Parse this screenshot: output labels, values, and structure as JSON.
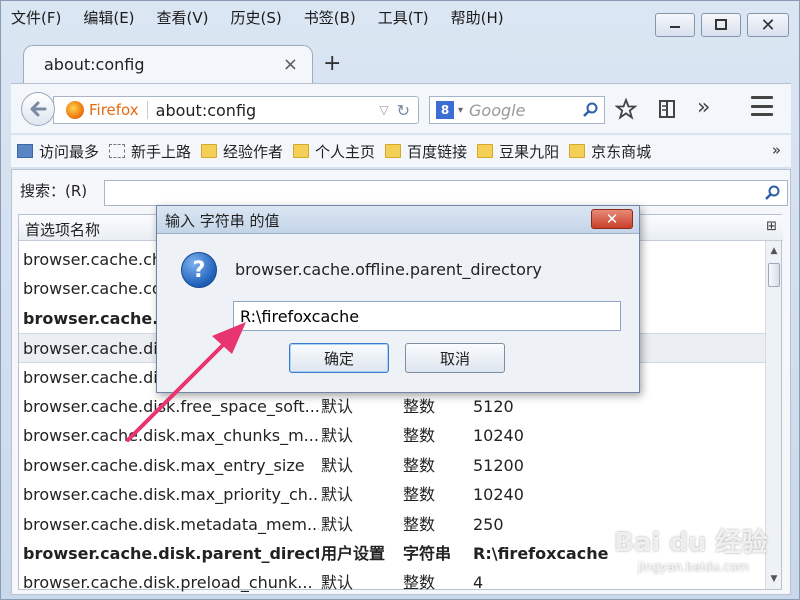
{
  "menu": [
    "文件(F)",
    "编辑(E)",
    "查看(V)",
    "历史(S)",
    "书签(B)",
    "工具(T)",
    "帮助(H)"
  ],
  "window_buttons": {
    "minimize": "▭",
    "maximize": "□",
    "close": "✕"
  },
  "tab": {
    "title": "about:config",
    "close": "×",
    "new_tab": "+"
  },
  "nav": {
    "identity_label": "Firefox",
    "url": "about:config",
    "search_engine_icon": "8",
    "search_placeholder": "Google"
  },
  "bookmarks": [
    {
      "label": "访问最多",
      "icon": "blue"
    },
    {
      "label": "新手上路",
      "icon": "dashed"
    },
    {
      "label": "经验作者",
      "icon": "folder"
    },
    {
      "label": "个人主页",
      "icon": "folder"
    },
    {
      "label": "百度链接",
      "icon": "folder"
    },
    {
      "label": "豆果九阳",
      "icon": "folder"
    },
    {
      "label": "京东商城",
      "icon": "folder"
    }
  ],
  "bookmarks_more": "»",
  "config": {
    "search_label": "搜索：(R)",
    "search_value": "",
    "column_header": "首选项名称",
    "rows": [
      {
        "name": "browser.cache.che",
        "status": "",
        "type": "",
        "value": "",
        "bold": false,
        "selected": false
      },
      {
        "name": "browser.cache.co",
        "status": "",
        "type": "",
        "value": "",
        "bold": false,
        "selected": false
      },
      {
        "name": "browser.cache.di",
        "status": "",
        "type": "",
        "value": "",
        "bold": true,
        "selected": false
      },
      {
        "name": "browser.cache.dis",
        "status": "",
        "type": "",
        "value": "",
        "bold": false,
        "selected": true
      },
      {
        "name": "browser.cache.dis",
        "status": "",
        "type": "",
        "value": "",
        "bold": false,
        "selected": false
      },
      {
        "name": "browser.cache.disk.free_space_soft...",
        "status": "默认",
        "type": "整数",
        "value": "5120",
        "bold": false,
        "selected": false
      },
      {
        "name": "browser.cache.disk.max_chunks_m...",
        "status": "默认",
        "type": "整数",
        "value": "10240",
        "bold": false,
        "selected": false
      },
      {
        "name": "browser.cache.disk.max_entry_size",
        "status": "默认",
        "type": "整数",
        "value": "51200",
        "bold": false,
        "selected": false
      },
      {
        "name": "browser.cache.disk.max_priority_ch...",
        "status": "默认",
        "type": "整数",
        "value": "10240",
        "bold": false,
        "selected": false
      },
      {
        "name": "browser.cache.disk.metadata_mem...",
        "status": "默认",
        "type": "整数",
        "value": "250",
        "bold": false,
        "selected": false
      },
      {
        "name": "browser.cache.disk.parent_direct...",
        "status": "用户设置",
        "type": "字符串",
        "value": "R:\\firefoxcache",
        "bold": true,
        "selected": false
      },
      {
        "name": "browser.cache.disk.preload_chunk...",
        "status": "默认",
        "type": "整数",
        "value": "4",
        "bold": false,
        "selected": false
      }
    ]
  },
  "dialog": {
    "title": "输入 字符串 的值",
    "message": "browser.cache.offline.parent_directory",
    "input_value": "R:\\firefoxcache",
    "ok_label": "确定",
    "cancel_label": "取消",
    "close_label": "✕"
  },
  "watermark": {
    "text": "Bai du 经验",
    "sub": "jingyan.baidu.com"
  },
  "colors": {
    "arrow": "#e8356f",
    "firefox_orange": "#e66a12",
    "close_red": "#c7402a"
  }
}
